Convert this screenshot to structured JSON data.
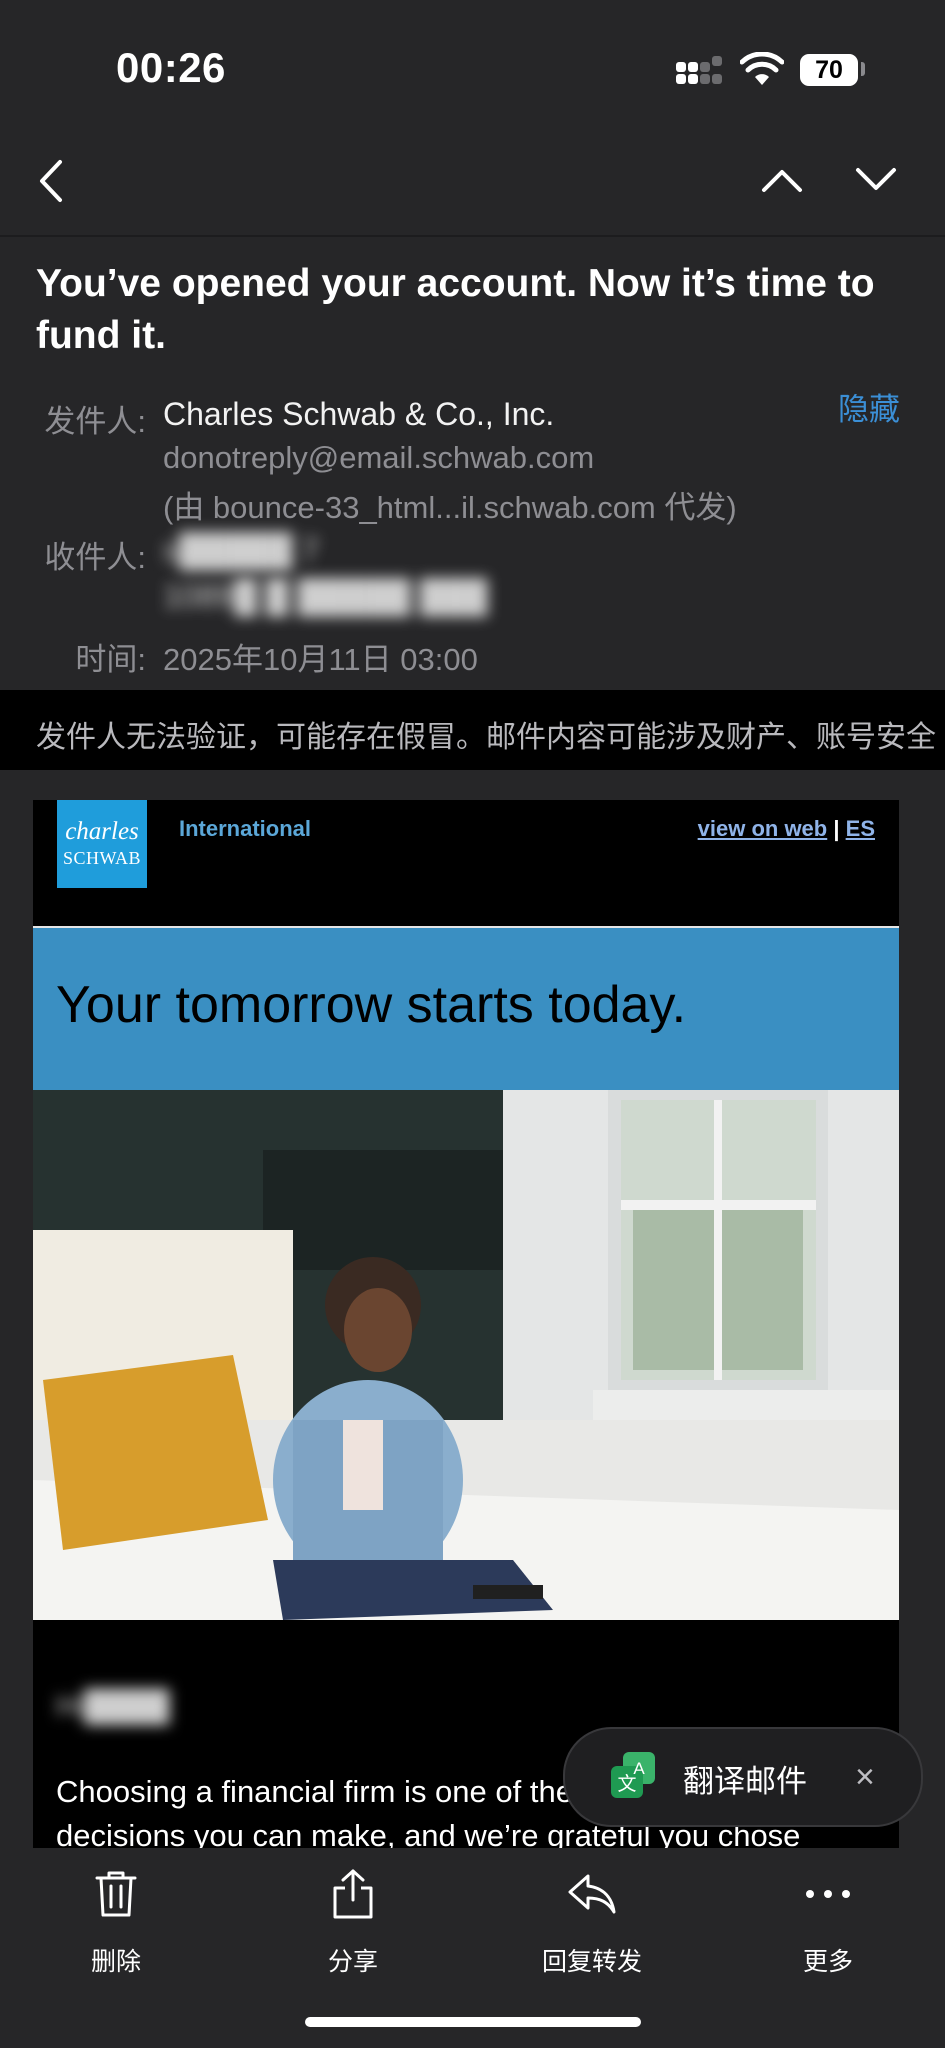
{
  "status_bar": {
    "time": "00:26",
    "battery": "70"
  },
  "header": {
    "subject": "You’ve opened your account. Now it’s time to fund it.",
    "hide_label": "隐藏",
    "from_label": "发件人:",
    "from_name": "Charles Schwab & Co., Inc.",
    "from_email": "donotreply@email.schwab.com",
    "from_via": "(由 bounce-33_html...il.schwab.com 代发)",
    "to_label": "收件人:",
    "to_line1": "s█████ 7",
    "to_line2": "1089█ █ █████ ███",
    "time_label": "时间:",
    "time_value": "2025年10月11日 03:00"
  },
  "warning": {
    "text": "发件人无法验证，可能存在假冒。邮件内容可能涉及财产、账号安全"
  },
  "email": {
    "logo_line1": "charles",
    "logo_line2": "SCHWAB",
    "region": "International",
    "view_on_web": "view on web",
    "separator": "|",
    "lang_es": "ES",
    "hero_text": "Your tomorrow starts today.",
    "greeting": "Hi████",
    "body": "Choosing a financial firm is one of the most important decisions you can make, and we’re grateful you chose"
  },
  "translate": {
    "label": "翻译邮件",
    "close": "×"
  },
  "toolbar": {
    "delete": "删除",
    "share": "分享",
    "reply_forward": "回复转发",
    "more": "更多"
  }
}
